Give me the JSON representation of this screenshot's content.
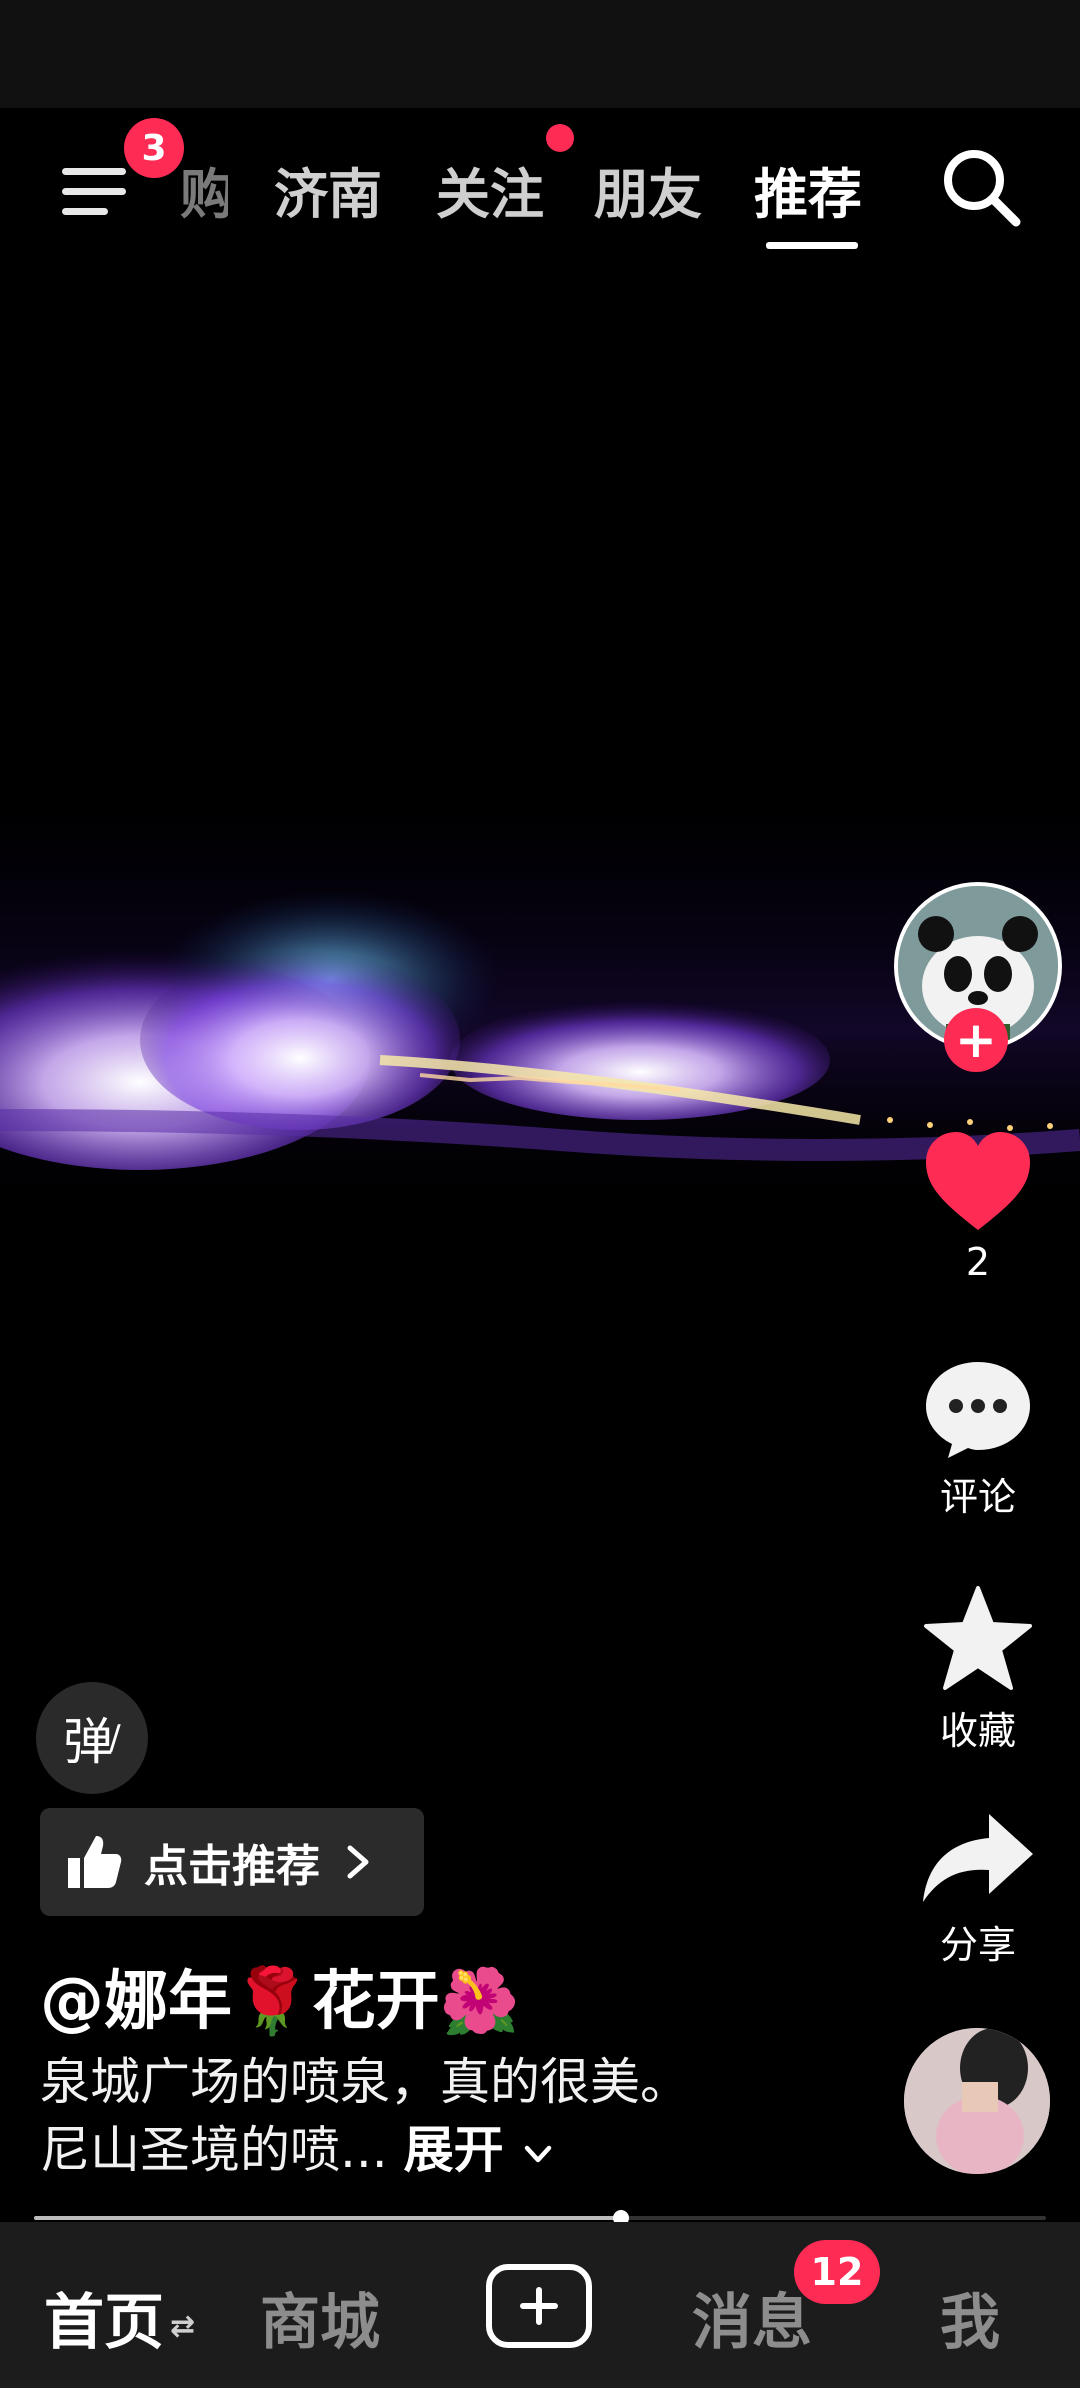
{
  "top_nav": {
    "menu_badge": "3",
    "tabs": [
      {
        "label": "购",
        "partial": true
      },
      {
        "label": "济南"
      },
      {
        "label": "关注"
      },
      {
        "label": "朋友"
      },
      {
        "label": "推荐",
        "active": true
      }
    ],
    "follow_tab_dot": true
  },
  "video": {
    "caption_author": "@娜年🌹花开🌺",
    "description": "泉城广场的喷泉，真的很美。尼山圣境的喷...",
    "expand_label": "展开",
    "progress": 0.58
  },
  "rail": {
    "like_count": "2",
    "comment_label": "评论",
    "favorite_label": "收藏",
    "share_label": "分享"
  },
  "controls": {
    "danmu_label": "弹",
    "recommend_label": "点击推荐"
  },
  "bottom_nav": {
    "home": "首页",
    "mall": "商城",
    "messages": "消息",
    "messages_badge": "12",
    "me": "我"
  },
  "colors": {
    "accent": "#fe2c55",
    "background": "#000000",
    "bottom_bar": "#1c1c1c"
  }
}
